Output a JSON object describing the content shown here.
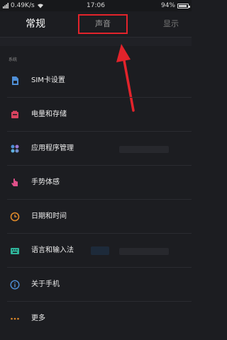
{
  "status_bar": {
    "network_speed": "0.49K/s",
    "time": "17:06",
    "battery_percent": "94%",
    "battery_level": 0.94
  },
  "tabs": [
    {
      "label": "常规",
      "selected": true
    },
    {
      "label": "声音",
      "selected": false,
      "highlighted": true
    },
    {
      "label": "显示",
      "selected": false
    }
  ],
  "section_label": "系统",
  "settings": [
    {
      "label": "SIM卡设置",
      "icon": "sim-card-icon",
      "color": "#4f8fd6"
    },
    {
      "label": "电量和存储",
      "icon": "battery-storage-icon",
      "color": "#d8435f"
    },
    {
      "label": "应用程序管理",
      "icon": "apps-icon",
      "color": "#6f8fcf"
    },
    {
      "label": "手势体感",
      "icon": "gesture-hand-icon",
      "color": "#e0508a"
    },
    {
      "label": "日期和时间",
      "icon": "clock-icon",
      "color": "#e08a2a"
    },
    {
      "label": "语言和输入法",
      "icon": "keyboard-icon",
      "color": "#2fb59b"
    },
    {
      "label": "关于手机",
      "icon": "info-icon",
      "color": "#4f8fd6"
    },
    {
      "label": "更多",
      "icon": "more-dots-icon",
      "color": "#e08a2a"
    }
  ],
  "annotation_color": "#e2232b"
}
